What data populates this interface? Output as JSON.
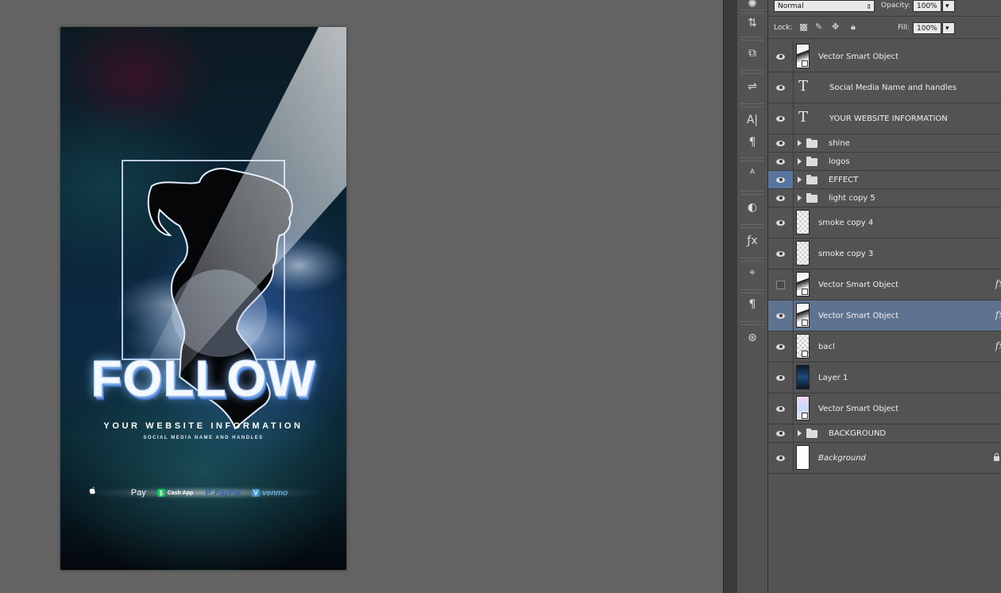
{
  "canvas": {
    "title": "FOLLOW",
    "website": "YOUR WEBSITE INFORMATION",
    "handles": "SOCIAL MEDIA NAME AND HANDLES",
    "payments": [
      {
        "mark": "",
        "label": "Pay"
      },
      {
        "mark": "$",
        "label": "Cash App"
      },
      {
        "mark": "P",
        "label": "PayPal"
      },
      {
        "mark": "V",
        "label": "venmo"
      }
    ]
  },
  "layers_panel": {
    "blend_mode": "Normal",
    "opacity_label": "Opacity:",
    "opacity_value": "100%",
    "lock_label": "Lock:",
    "fill_label": "Fill:",
    "fill_value": "100%",
    "layers": [
      {
        "name": "Vector Smart Object",
        "kind": "smart"
      },
      {
        "name": "Social Media Name and handles",
        "kind": "type"
      },
      {
        "name": "YOUR WEBSITE INFORMATION",
        "kind": "type"
      },
      {
        "name": "shine",
        "kind": "group"
      },
      {
        "name": "logos",
        "kind": "group"
      },
      {
        "name": "EFFECT",
        "kind": "group",
        "eye_active": true
      },
      {
        "name": "light copy 5",
        "kind": "group"
      },
      {
        "name": "smoke copy 4",
        "kind": "raster"
      },
      {
        "name": "smoke copy 3",
        "kind": "raster"
      },
      {
        "name": "Vector Smart Object",
        "kind": "smart",
        "hidden": true,
        "fx": "fx"
      },
      {
        "name": "Vector Smart Object",
        "kind": "smart",
        "selected": true,
        "fx": "fx"
      },
      {
        "name": "bacl",
        "kind": "raster",
        "fx": "fx"
      },
      {
        "name": "Layer 1",
        "kind": "raster"
      },
      {
        "name": "Vector Smart Object",
        "kind": "smart"
      },
      {
        "name": "BACKGROUND",
        "kind": "group"
      },
      {
        "name": "Background",
        "kind": "background",
        "locked": true
      }
    ]
  },
  "colors": {
    "workspace": "#636363",
    "panel": "#535353",
    "selection": "#5e7390",
    "accent_blue": "#6f9fe0"
  }
}
